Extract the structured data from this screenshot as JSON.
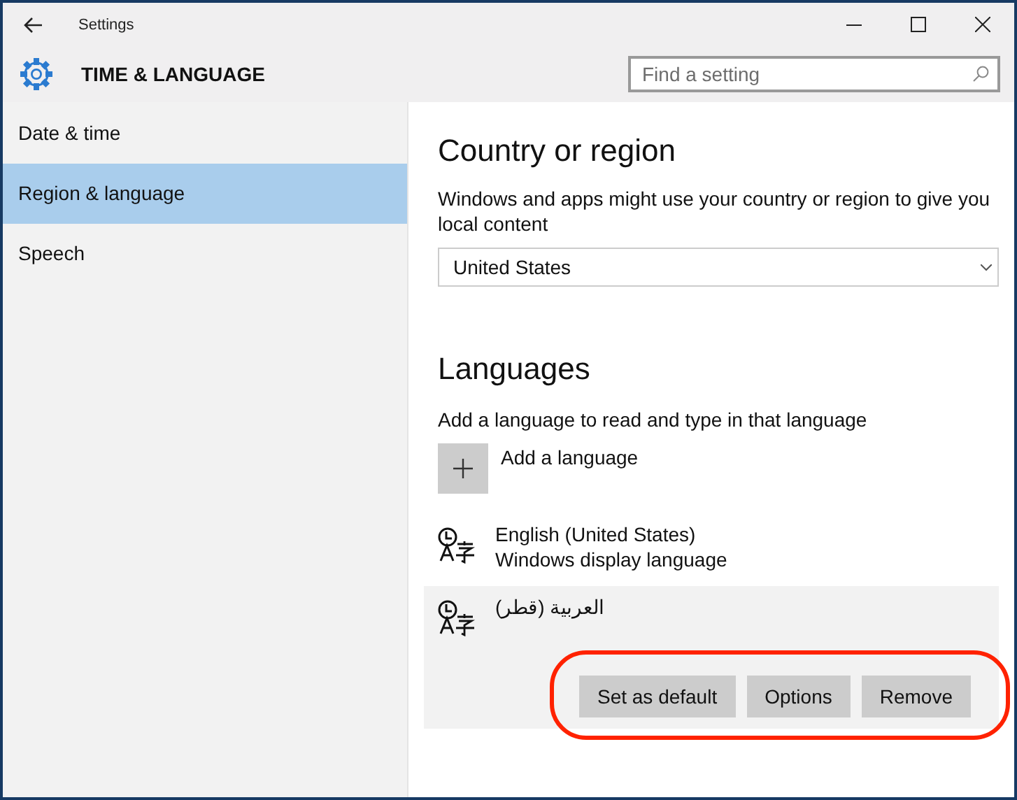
{
  "window": {
    "title": "Settings"
  },
  "header": {
    "title": "TIME & LANGUAGE",
    "search": {
      "placeholder": "Find a setting"
    }
  },
  "sidebar": {
    "items": [
      {
        "label": "Date & time",
        "selected": false
      },
      {
        "label": "Region & language",
        "selected": true
      },
      {
        "label": "Speech",
        "selected": false
      }
    ]
  },
  "country": {
    "heading": "Country or region",
    "description": "Windows and apps might use your country or region to give you local content",
    "value": "United States"
  },
  "languages": {
    "heading": "Languages",
    "description": "Add a language to read and type in that language",
    "add_label": "Add a language",
    "items": [
      {
        "name": "English (United States)",
        "subtitle": "Windows display language",
        "selected": false
      },
      {
        "name": "العربية (قطر)",
        "selected": true,
        "highlighted": true,
        "actions": [
          {
            "label": "Set as default"
          },
          {
            "label": "Options"
          },
          {
            "label": "Remove"
          }
        ]
      }
    ]
  }
}
